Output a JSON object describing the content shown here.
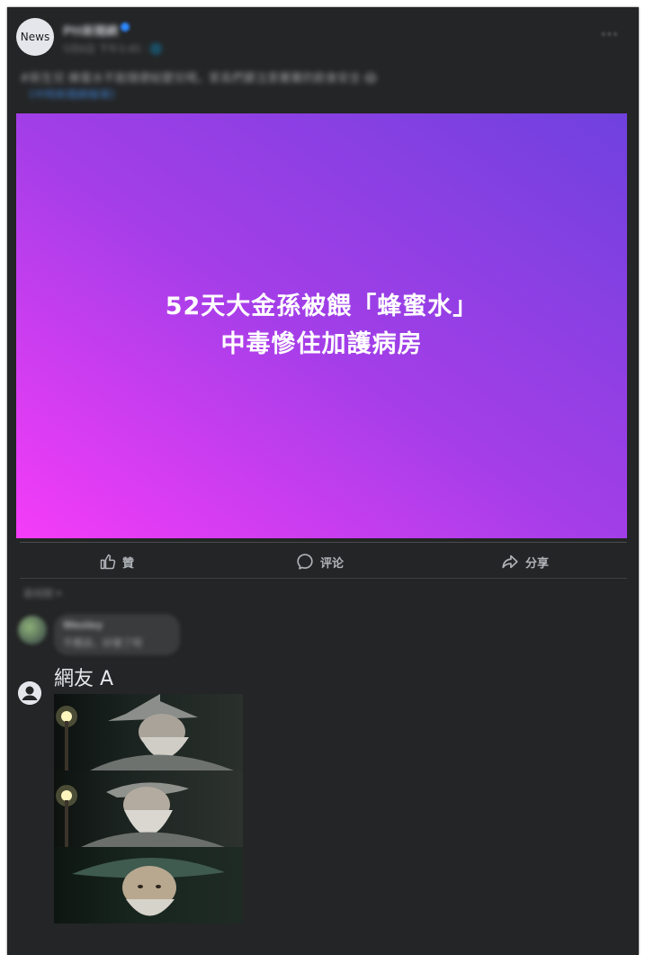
{
  "post": {
    "avatar_label": "News",
    "page_name": "Ptt新聞網",
    "meta": "5月6日 下午3:45 · 🌐",
    "more": "···",
    "caption": "#新生兒 蜂蜜水不能隨便給嬰兒喝，家長們要注意寶寶的飲食安全 😱",
    "caption_link": "《中時新聞網報導》",
    "hero_lines": [
      "52天大金孫被餵「蜂蜜水」",
      "中毒慘住加護病房"
    ]
  },
  "actions": {
    "like": "贊",
    "comment": "评论",
    "share": "分享"
  },
  "comments": {
    "sort_label": "最相關 ▾",
    "blurred": {
      "author": "Wesley",
      "text": "不應該，好傻了呀"
    },
    "meme_comment": {
      "author": "網友 A"
    }
  },
  "colors": {
    "background": "#242526",
    "text_primary": "#e4e6eb",
    "text_secondary": "#b0b3b8",
    "gradient_start": "#f53cf8",
    "gradient_end": "#6f41de"
  },
  "icons": [
    "like-icon",
    "comment-icon",
    "share-icon",
    "user-icon",
    "verified-icon",
    "more-icon"
  ]
}
